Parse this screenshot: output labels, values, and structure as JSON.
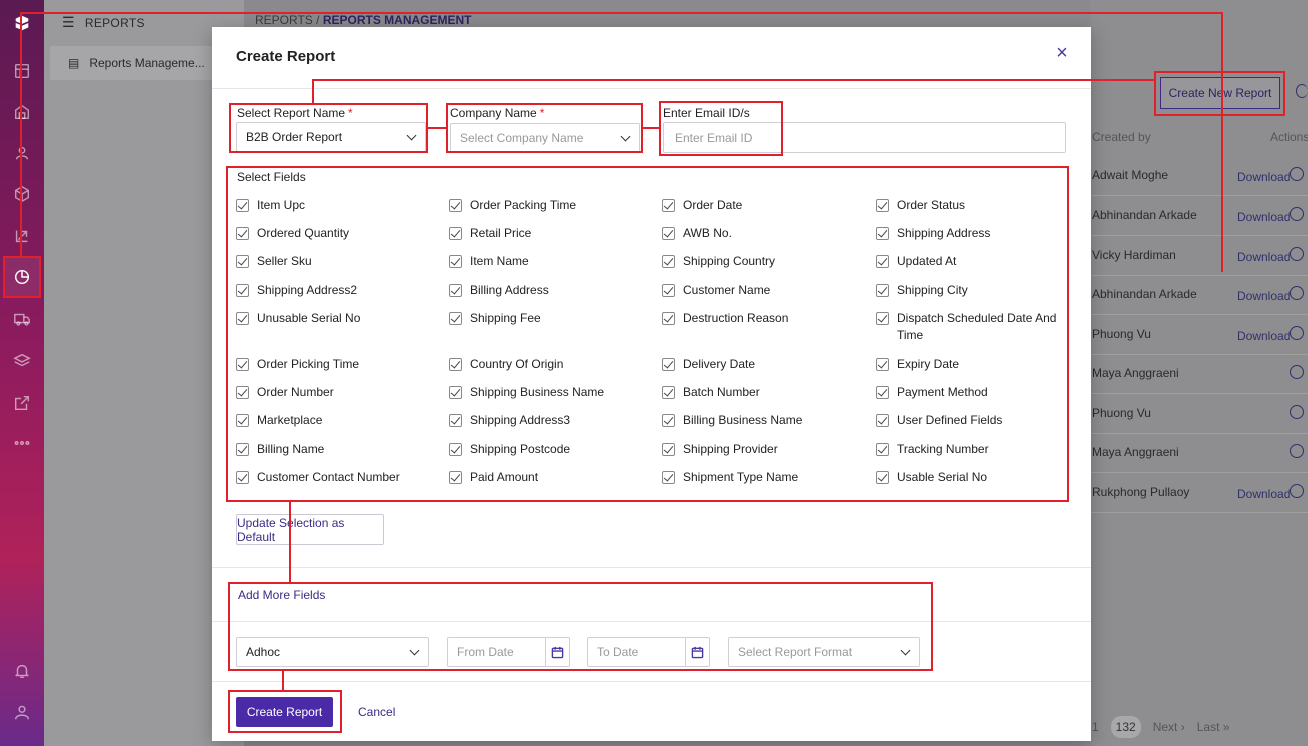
{
  "sidebar": {
    "header": "REPORTS",
    "item": "Reports Manageme..."
  },
  "breadcrumb": {
    "root": "REPORTS",
    "sep": "/",
    "current": "REPORTS MANAGEMENT"
  },
  "background": {
    "create_new_label": "Create New Report",
    "created_by_header": "Created by",
    "actions_header": "Actions",
    "rows": [
      {
        "name": "Adwait Moghe",
        "action": "Download"
      },
      {
        "name": "Abhinandan Arkade",
        "action": "Download"
      },
      {
        "name": "Vicky Hardiman",
        "action": "Download"
      },
      {
        "name": "Abhinandan Arkade",
        "action": "Download"
      },
      {
        "name": "Phuong Vu",
        "action": "Download"
      },
      {
        "name": "Maya Anggraeni",
        "action": ""
      },
      {
        "name": "Phuong Vu",
        "action": ""
      },
      {
        "name": "Maya Anggraeni",
        "action": ""
      },
      {
        "name": "Rukphong Pullaoy",
        "action": "Download"
      }
    ],
    "pager": {
      "prev_page": "1",
      "current_page": "132",
      "next": "Next",
      "last": "Last"
    }
  },
  "modal": {
    "title": "Create Report",
    "close_symbol": "×",
    "report_name": {
      "label": "Select Report Name",
      "required": "*",
      "value": "B2B Order Report"
    },
    "company_name": {
      "label": "Company Name",
      "required": "*",
      "placeholder": "Select Company Name"
    },
    "email": {
      "label": "Enter Email ID/s",
      "placeholder": "Enter Email ID"
    },
    "select_fields_title": "Select Fields",
    "fields": [
      [
        "Item Upc",
        "Order Packing Time",
        "Order Date",
        "Order Status"
      ],
      [
        "Ordered Quantity",
        "Retail Price",
        "AWB No.",
        "Shipping Address"
      ],
      [
        "Seller Sku",
        "Item Name",
        "Shipping Country",
        "Updated At"
      ],
      [
        "Shipping Address2",
        "Billing Address",
        "Customer Name",
        "Shipping City"
      ],
      [
        "Unusable Serial No",
        "Shipping Fee",
        "Destruction Reason",
        "Dispatch Scheduled Date And Time"
      ],
      [
        "Order Picking Time",
        "Country Of Origin",
        "Delivery Date",
        "Expiry Date"
      ],
      [
        "Order Number",
        "Shipping Business Name",
        "Batch Number",
        "Payment Method"
      ],
      [
        "Marketplace",
        "Shipping Address3",
        "Billing Business Name",
        "User Defined Fields"
      ],
      [
        "Billing Name",
        "Shipping Postcode",
        "Shipping Provider",
        "Tracking Number"
      ],
      [
        "Customer Contact Number",
        "Paid Amount",
        "Shipment Type Name",
        "Usable Serial No"
      ]
    ],
    "update_default_label": "Update Selection as Default",
    "add_more_label": "Add More Fields",
    "frequency_value": "Adhoc",
    "from_date_placeholder": "From Date",
    "to_date_placeholder": "To Date",
    "format_placeholder": "Select Report Format",
    "create_label": "Create Report",
    "cancel_label": "Cancel"
  },
  "colors": {
    "accent": "#4b2aa8",
    "annotation": "#e0202a"
  }
}
